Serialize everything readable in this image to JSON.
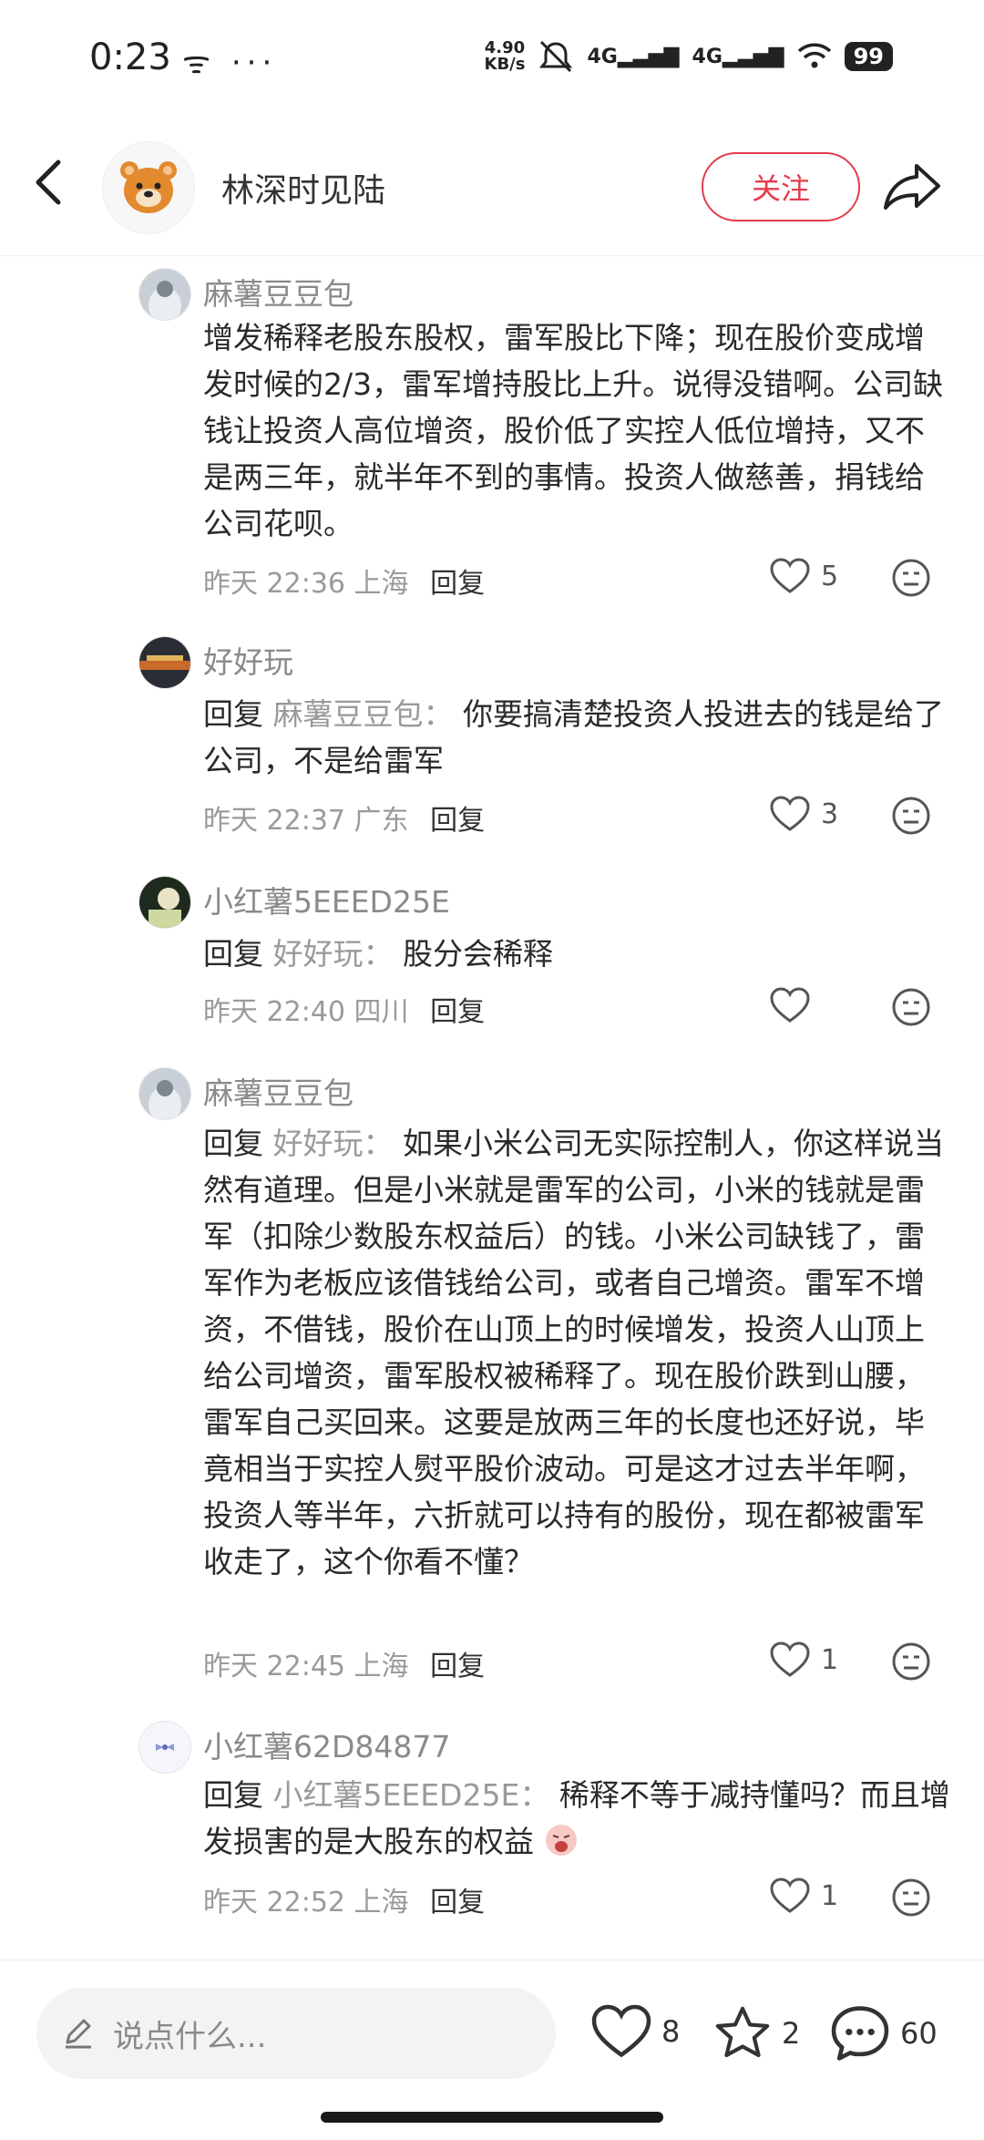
{
  "status_bar": {
    "time": "0:23",
    "left_icons": "ᯤ ···",
    "speed_value": "4.90",
    "speed_unit": "KB/s",
    "sig1": "4G",
    "sig2": "4G",
    "battery": "99"
  },
  "header": {
    "author": "林深时见陆",
    "follow_label": "关注"
  },
  "comments": [
    {
      "name": "麻薯豆豆包",
      "reply_prefix": "",
      "reply_to": "",
      "text": "增发稀释老股东股权，雷军股比下降；现在股价变成增发时候的2/3，雷军增持股比上升。说得没错啊。公司缺钱让投资人高位增资，股价低了实控人低位增持，又不是两三年，就半年不到的事情。投资人做慈善，捐钱给公司花呗。",
      "time": "昨天 22:36 上海",
      "reply_label": "回复",
      "likes": "5"
    },
    {
      "name": "好好玩",
      "reply_prefix": "回复",
      "reply_to": "麻薯豆豆包",
      "text": "你要搞清楚投资人投进去的钱是给了公司，不是给雷军",
      "time": "昨天 22:37 广东",
      "reply_label": "回复",
      "likes": "3"
    },
    {
      "name": "小红薯5EEED25E",
      "reply_prefix": "回复",
      "reply_to": "好好玩",
      "text": "股分会稀释",
      "time": "昨天 22:40 四川",
      "reply_label": "回复",
      "likes": ""
    },
    {
      "name": "麻薯豆豆包",
      "reply_prefix": "回复",
      "reply_to": "好好玩",
      "text": "如果小米公司无实际控制人，你这样说当然有道理。但是小米就是雷军的公司，小米的钱就是雷军（扣除少数股东权益后）的钱。小米公司缺钱了，雷军作为老板应该借钱给公司，或者自己增资。雷军不增资，不借钱，股价在山顶上的时候增发，投资人山顶上给公司增资，雷军股权被稀释了。现在股价跌到山腰，雷军自己买回来。这要是放两三年的长度也还好说，毕竟相当于实控人熨平股价波动。可是这才过去半年啊，投资人等半年，六折就可以持有的股份，现在都被雷军收走了，这个你看不懂？",
      "time": "昨天 22:45 上海",
      "reply_label": "回复",
      "likes": "1"
    },
    {
      "name": "小红薯62D84877",
      "reply_prefix": "回复",
      "reply_to": "小红薯5EEED25E",
      "text": "稀释不等于减持懂吗？而且增发损害的是大股东的权益",
      "time": "昨天 22:52 上海",
      "reply_label": "回复",
      "likes": "1"
    }
  ],
  "bottom_bar": {
    "input_placeholder": "说点什么...",
    "likes": "8",
    "stars": "2",
    "comments": "60"
  },
  "colors": {
    "accent": "#e33c4b",
    "muted_text": "#9a9a9a"
  }
}
